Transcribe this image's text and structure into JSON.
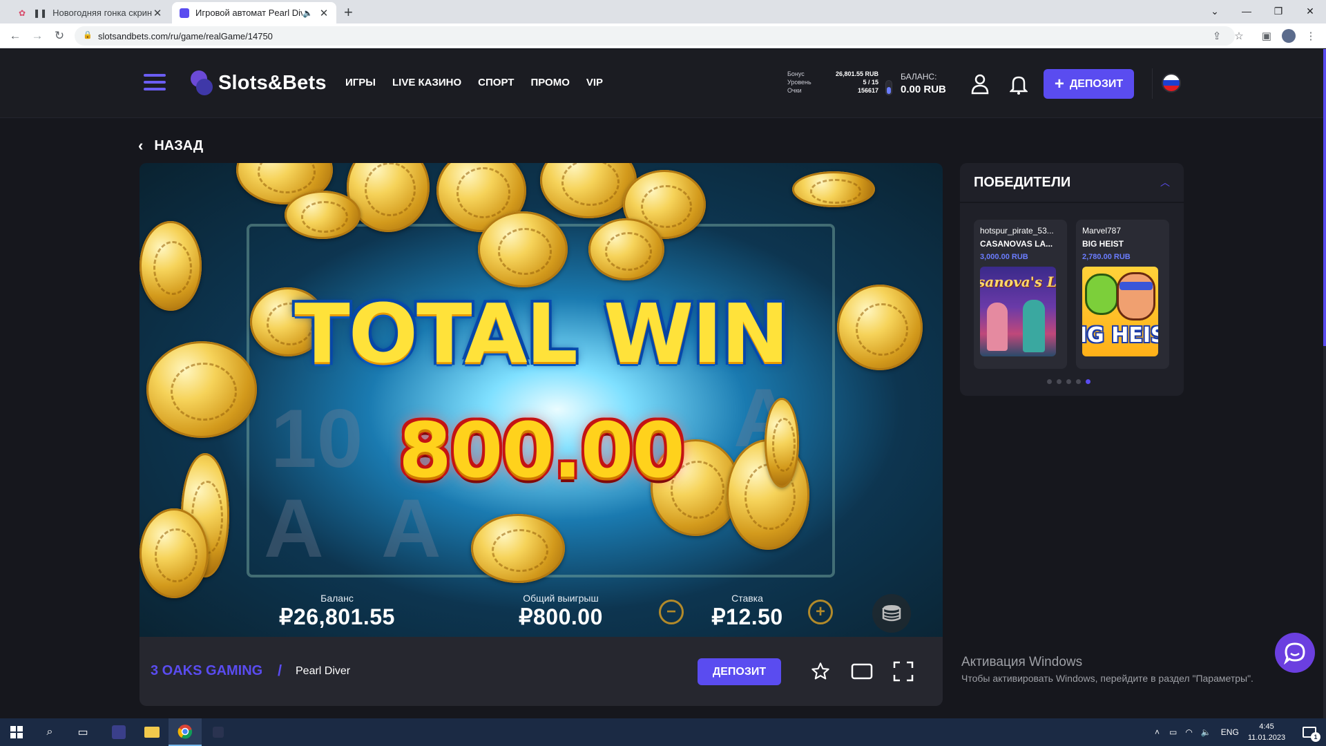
{
  "browser": {
    "tabs": [
      {
        "title": "Новогодняя гонка скриншотов",
        "active": false
      },
      {
        "title": "Игровой автомат Pearl Diver",
        "active": true
      }
    ],
    "url": "slotsandbets.com/ru/game/realGame/14750"
  },
  "site": {
    "logo": "Slots&Bets",
    "nav": [
      "ИГРЫ",
      "LIVE КАЗИНО",
      "СПОРТ",
      "ПРОМО",
      "VIP"
    ],
    "bonus": {
      "label_bonus": "Бонус",
      "label_level": "Уровень",
      "label_points": "Очки",
      "bonus_value": "26,801.55 RUB",
      "level_value": "5 / 15",
      "points_value": "156617"
    },
    "balance_label": "БАЛАНС:",
    "balance_value": "0.00 RUB",
    "deposit_label": "ДЕПОЗИТ",
    "accent_color": "#5a4cf0"
  },
  "back_label": "НАЗАД",
  "game": {
    "headline": "TOTAL WIN",
    "win_amount": "800.00",
    "hud": {
      "balance_label": "Баланс",
      "balance_value": "₽26,801.55",
      "total_win_label": "Общий выигрыш",
      "total_win_value": "₽800.00",
      "bet_label": "Ставка",
      "bet_value": "₽12.50"
    },
    "provider": "3 OAKS GAMING",
    "separator": "/",
    "name": "Pearl Diver",
    "deposit_label": "ДЕПОЗИТ"
  },
  "winners": {
    "title": "ПОБЕДИТЕЛИ",
    "cards": [
      {
        "user": "hotspur_pirate_53...",
        "game": "CASANOVAS LA...",
        "amount": "3,000.00 RUB",
        "thumb_text": "sanova's Lo"
      },
      {
        "user": "Marvel787",
        "game": "BIG HEIST",
        "amount": "2,780.00 RUB",
        "thumb_text": "IG HEIS"
      }
    ],
    "active_dot": 5
  },
  "windows_activation": {
    "title": "Активация Windows",
    "subtitle": "Чтобы активировать Windows, перейдите в раздел \"Параметры\"."
  },
  "taskbar": {
    "lang": "ENG",
    "time": "4:45",
    "date": "11.01.2023",
    "notifications": "1"
  }
}
